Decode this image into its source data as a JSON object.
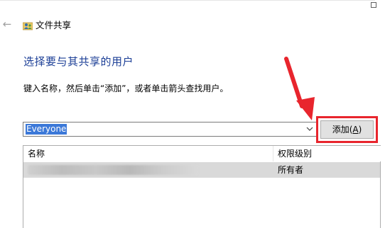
{
  "window": {
    "back_icon": "back-arrow-icon",
    "title": "文件共享",
    "title_icon": "file-sharing-icon"
  },
  "main": {
    "heading": "选择要与其共享的用户",
    "instruction": "键入名称，然后单击“添加”，或者单击箭头查找用户。",
    "combo_value": "Everyone",
    "add_button_text": "添加",
    "add_button_mnemonic": "A",
    "highlight_color": "#e8252d"
  },
  "table": {
    "columns": [
      "名称",
      "权限级别"
    ],
    "rows": [
      {
        "name_redacted": true,
        "permission": "所有者"
      }
    ]
  }
}
